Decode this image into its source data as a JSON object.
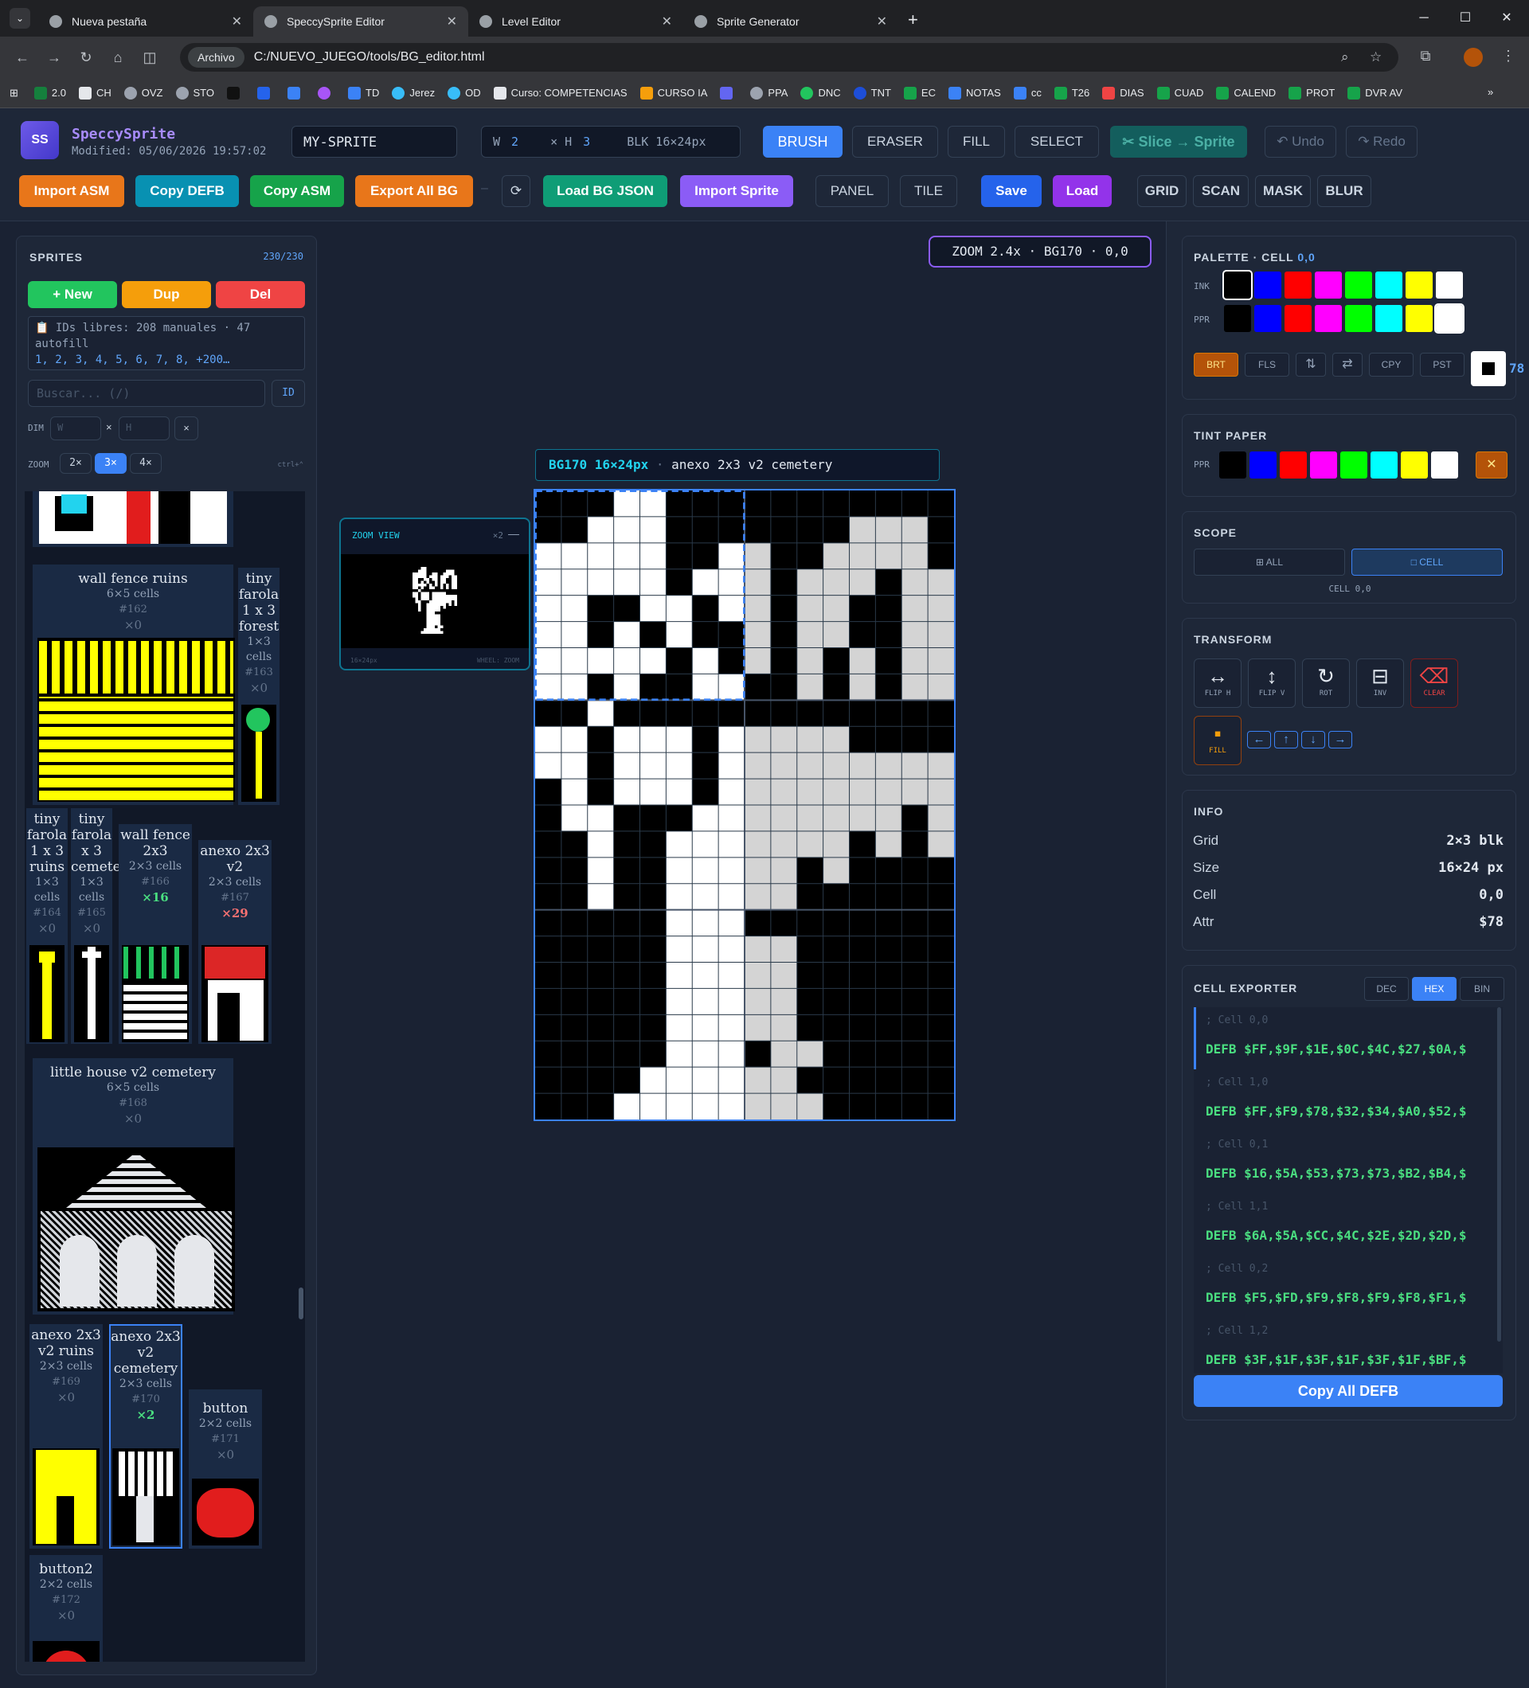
{
  "browser": {
    "tabs": [
      {
        "label": "Nueva pestaña",
        "active": false
      },
      {
        "label": "SpeccySprite Editor",
        "active": true
      },
      {
        "label": "Level Editor",
        "active": false
      },
      {
        "label": "Sprite Generator",
        "active": false
      }
    ],
    "scheme_chip": "Archivo",
    "url": "C:/NUEVO_JUEGO/tools/BG_editor.html",
    "bookmarks": [
      "2.0",
      "CH",
      "OVZ",
      "STO",
      "",
      "",
      "",
      "",
      "TD",
      "Jerez",
      "OD",
      "Curso: COMPETENCIAS",
      "CURSO IA",
      "",
      "PPA",
      "DNC",
      "TNT",
      "EC",
      "NOTAS",
      "cc",
      "T26",
      "DIAS",
      "CUAD",
      "CALEND",
      "PROT",
      "DVR AV"
    ]
  },
  "header": {
    "logo": "SS",
    "app_name": "SpeccySprite",
    "modified": "Modified: 05/06/2026 19:57:02",
    "sprite_name": "MY-SPRITE",
    "w_label": "W",
    "w_value": "2",
    "h_label": "× H",
    "h_value": "3",
    "blk": "BLK 16×24px",
    "tools": [
      "BRUSH",
      "ERASER",
      "FILL",
      "SELECT"
    ],
    "slice": "✂ Slice → Sprite",
    "undo": "↶ Undo",
    "redo": "↷ Redo",
    "row2": {
      "import_asm": "Import ASM",
      "copy_defb": "Copy DEFB",
      "copy_asm": "Copy ASM",
      "export_all_bg": "Export All BG",
      "dash": "–",
      "refresh": "⟳",
      "load_bg_json": "Load BG JSON",
      "import_sprite": "Import Sprite",
      "panel": "PANEL",
      "tile": "TILE",
      "save": "Save",
      "load": "Load",
      "grid": "GRID",
      "scan": "SCAN",
      "mask": "MASK",
      "blur": "BLUR"
    }
  },
  "sprites_panel": {
    "title": "SPRITES",
    "count": "230/230",
    "new": "+ New",
    "dup": "Dup",
    "del": "Del",
    "free_ids": "📋 IDs libres: 208 manuales · 47 autofill",
    "free_list": "1, 2, 3, 4, 5, 6, 7, 8, +200…",
    "search_placeholder": "Buscar... (/)",
    "id_btn": "ID",
    "dim_label": "DIM",
    "w_ph": "W",
    "x": "×",
    "h_ph": "H",
    "clear": "×",
    "zoom_label": "ZOOM",
    "zooms": [
      "2×",
      "3×",
      "4×"
    ],
    "ctrl_hint": "ctrl+⌃",
    "tiles": [
      {
        "name": "wall fence ruins",
        "cells": "6×5 cells",
        "id": "#162",
        "count": "×0"
      },
      {
        "name": "tiny farola 1 x 3 forest",
        "cells": "1×3 cells",
        "id": "#163",
        "count": "×0"
      },
      {
        "name": "tiny farola 1 x 3 ruins",
        "cells": "1×3 cells",
        "id": "#164",
        "count": "×0"
      },
      {
        "name": "tiny farola x 3 cemetery",
        "cells": "1×3 cells",
        "id": "#165",
        "count": "×0"
      },
      {
        "name": "wall fence 2x3",
        "cells": "2×3 cells",
        "id": "#166",
        "count": "×16"
      },
      {
        "name": "anexo 2x3 v2",
        "cells": "2×3 cells",
        "id": "#167",
        "count": "×29"
      },
      {
        "name": "little house v2 cemetery",
        "cells": "6×5 cells",
        "id": "#168",
        "count": "×0"
      },
      {
        "name": "anexo 2x3 v2 ruins",
        "cells": "2×3 cells",
        "id": "#169",
        "count": "×0"
      },
      {
        "name": "anexo 2x3 v2 cemetery",
        "cells": "2×3 cells",
        "id": "#170",
        "count": "×2"
      },
      {
        "name": "button",
        "cells": "2×2 cells",
        "id": "#171",
        "count": "×0"
      },
      {
        "name": "button2",
        "cells": "2×2 cells",
        "id": "#172",
        "count": "×0"
      }
    ]
  },
  "canvas": {
    "zoom_status": "ZOOM 2.4x · BG170 · 0,0",
    "title_id": "BG170 16×24px",
    "title_name": "anexo 2x3 v2 cemetery",
    "zoom_view": {
      "title": "ZOOM VIEW",
      "scale": "×2",
      "min": "—",
      "size": "16×24px",
      "hint": "WHEEL: ZOOM"
    },
    "pixels": [
      "0001100000000000",
      "0011100000001110",
      "1111100110011110",
      "1111101110111011",
      "1100110110110011",
      "1101010010110011",
      "1111101010101011",
      "1101001100101011",
      "0010000000000000",
      "1101110111110000",
      "1101110111111111",
      "0101110111111111",
      "0110001111111101",
      "0010011111110101",
      "0010011111010000",
      "0010011111000000",
      "0000011100000000",
      "0000011111000000",
      "0000011111000000",
      "0000011111000000",
      "0000011111000000",
      "0000011101100000",
      "0000111111000000",
      "0001111111100000"
    ]
  },
  "palette_panel": {
    "title": "PALETTE · CELL",
    "cell": "0,0",
    "ink_label": "INK",
    "ppr_label": "PPR",
    "colors": [
      "#000000",
      "#0000ff",
      "#ff0000",
      "#ff00ff",
      "#00ff00",
      "#00ffff",
      "#ffff00",
      "#ffffff"
    ],
    "buttons": [
      "BRT",
      "FLS",
      "⇅",
      "⇄",
      "CPY",
      "PST"
    ],
    "attr_peek": "78"
  },
  "tint_panel": {
    "title": "TINT PAPER",
    "ppr_label": "PPR",
    "close": "✕"
  },
  "scope_panel": {
    "title": "SCOPE",
    "all": "⊞ ALL",
    "cell": "□ CELL",
    "cell_info": "CELL 0,0"
  },
  "transform_panel": {
    "title": "TRANSFORM",
    "buttons": [
      {
        "icon": "↔",
        "label": "FLIP H"
      },
      {
        "icon": "↕",
        "label": "FLIP V"
      },
      {
        "icon": "↻",
        "label": "ROT"
      },
      {
        "icon": "⊟",
        "label": "INV"
      },
      {
        "icon": "⌫",
        "label": "CLEAR"
      }
    ],
    "fill": {
      "icon": "▪",
      "label": "FILL"
    },
    "arrows": [
      "←",
      "↑",
      "↓",
      "→"
    ]
  },
  "info_panel": {
    "title": "INFO",
    "rows": [
      {
        "label": "Grid",
        "value": "2×3 blk"
      },
      {
        "label": "Size",
        "value": "16×24 px"
      },
      {
        "label": "Cell",
        "value": "0,0"
      },
      {
        "label": "Attr",
        "value": "$78"
      }
    ]
  },
  "exporter_panel": {
    "title": "CELL EXPORTER",
    "modes": [
      "DEC",
      "HEX",
      "BIN"
    ],
    "cells": [
      {
        "comment": "; Cell 0,0",
        "data": "DEFB $FF,$9F,$1E,$0C,$4C,$27,$0A,$"
      },
      {
        "comment": "; Cell 1,0",
        "data": "DEFB $FF,$F9,$78,$32,$34,$A0,$52,$"
      },
      {
        "comment": "; Cell 0,1",
        "data": "DEFB $16,$5A,$53,$73,$73,$B2,$B4,$"
      },
      {
        "comment": "; Cell 1,1",
        "data": "DEFB $6A,$5A,$CC,$4C,$2E,$2D,$2D,$"
      },
      {
        "comment": "; Cell 0,2",
        "data": "DEFB $F5,$FD,$F9,$F8,$F9,$F8,$F1,$"
      },
      {
        "comment": "; Cell 1,2",
        "data": "DEFB $3F,$1F,$3F,$1F,$3F,$1F,$BF,$"
      }
    ],
    "copy_all": "Copy All DEFB"
  }
}
